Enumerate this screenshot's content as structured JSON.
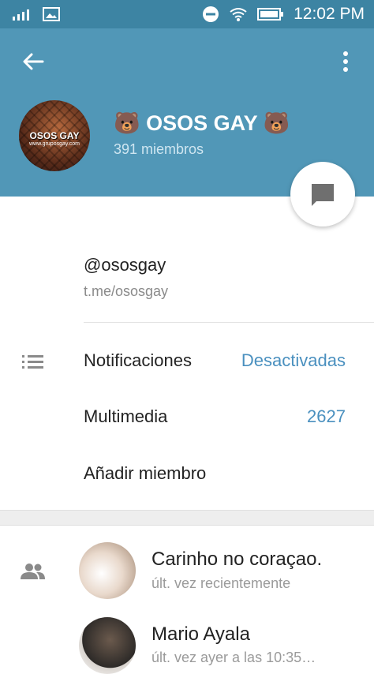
{
  "status_bar": {
    "time": "12:02 PM"
  },
  "header": {
    "title": "🐻 OSOS GAY 🐻",
    "members": "391 miembros",
    "avatar_text": "OSOS GAY",
    "avatar_sub": "www.gruposgay.com",
    "colors": {
      "bar": "#5197b7",
      "status": "#3d84a3"
    }
  },
  "info": {
    "username": "@ososgay",
    "link": "t.me/ososgay"
  },
  "settings": {
    "notifications_label": "Notificaciones",
    "notifications_value": "Desactivadas",
    "media_label": "Multimedia",
    "media_value": "2627",
    "add_member_label": "Añadir miembro",
    "accent": "#4a90bf"
  },
  "members": [
    {
      "name": "Carinho no coraçao.",
      "status": "últ. vez recientemente"
    },
    {
      "name": "Mario Ayala",
      "status": "últ. vez ayer a las 10:35…"
    }
  ]
}
